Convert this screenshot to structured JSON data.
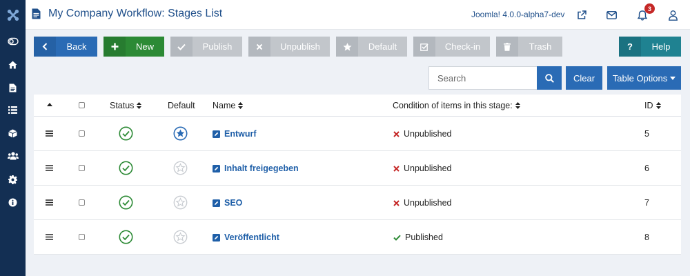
{
  "header": {
    "title": "My Company Workflow: Stages List",
    "version": "Joomla! 4.0.0-alpha7-dev",
    "notification_count": "3"
  },
  "sidebar": {
    "items": [
      {
        "icon": "toggle-menu-icon"
      },
      {
        "icon": "home-icon"
      },
      {
        "icon": "content-icon"
      },
      {
        "icon": "menus-icon"
      },
      {
        "icon": "components-icon"
      },
      {
        "icon": "users-icon"
      },
      {
        "icon": "system-icon"
      },
      {
        "icon": "help-info-icon"
      }
    ]
  },
  "toolbar": {
    "back": "Back",
    "new": "New",
    "publish": "Publish",
    "unpublish": "Unpublish",
    "default": "Default",
    "checkin": "Check-in",
    "trash": "Trash",
    "help": "Help",
    "help_icon": "?"
  },
  "search": {
    "placeholder": "Search",
    "value": "",
    "clear": "Clear",
    "table_options": "Table Options"
  },
  "table": {
    "columns": {
      "status": "Status",
      "default": "Default",
      "name": "Name",
      "condition": "Condition of items in this stage:",
      "id": "ID"
    },
    "rows": [
      {
        "name": "Entwurf",
        "condition": "Unpublished",
        "published": false,
        "is_default": true,
        "id": "5"
      },
      {
        "name": "Inhalt freigegeben",
        "condition": "Unpublished",
        "published": false,
        "is_default": false,
        "id": "6"
      },
      {
        "name": "SEO",
        "condition": "Unpublished",
        "published": false,
        "is_default": false,
        "id": "7"
      },
      {
        "name": "Veröffentlicht",
        "condition": "Published",
        "published": true,
        "is_default": false,
        "id": "8"
      }
    ]
  },
  "colors": {
    "sidebar": "#132f53",
    "primary": "#2a6bb5",
    "success": "#2c8a35",
    "help": "#1f8291",
    "danger": "#c52827",
    "muted": "#c2c6cb"
  }
}
